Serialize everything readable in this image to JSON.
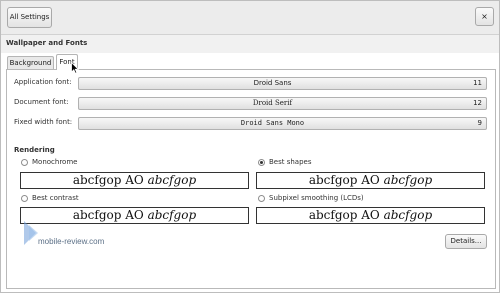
{
  "topbar": {
    "all_settings_label": "All Settings",
    "close_label": "×"
  },
  "header": {
    "title": "Wallpaper and Fonts"
  },
  "tabs": [
    {
      "label": "Background",
      "active": false
    },
    {
      "label": "Font",
      "active": true
    }
  ],
  "fonts": {
    "application": {
      "label": "Application font:",
      "name": "Droid Sans",
      "size": "11"
    },
    "document": {
      "label": "Document font:",
      "name": "Droid Serif",
      "size": "12"
    },
    "fixed": {
      "label": "Fixed width font:",
      "name": "Droid Sans Mono",
      "size": "9"
    }
  },
  "rendering": {
    "title": "Rendering",
    "options": [
      {
        "label": "Monochrome",
        "checked": false,
        "preview_roman": "abcfgop AO ",
        "preview_italic": "abcfgop"
      },
      {
        "label": "Best shapes",
        "checked": true,
        "preview_roman": "abcfgop AO ",
        "preview_italic": "abcfgop"
      },
      {
        "label": "Best contrast",
        "checked": false,
        "preview_roman": "abcfgop AO ",
        "preview_italic": "abcfgop"
      },
      {
        "label": "Subpixel smoothing (LCDs)",
        "checked": false,
        "preview_roman": "abcfgop AO ",
        "preview_italic": "abcfgop"
      }
    ]
  },
  "details_label": "Details...",
  "watermark": {
    "text": "mobile-review.com"
  },
  "colors": {
    "topbar_bg": "#ececec",
    "panel_border": "#b9b9b9",
    "watermark_blue": "#5b6f86"
  },
  "icons": {
    "cursor": "mouse-pointer-icon",
    "close": "close-icon"
  }
}
